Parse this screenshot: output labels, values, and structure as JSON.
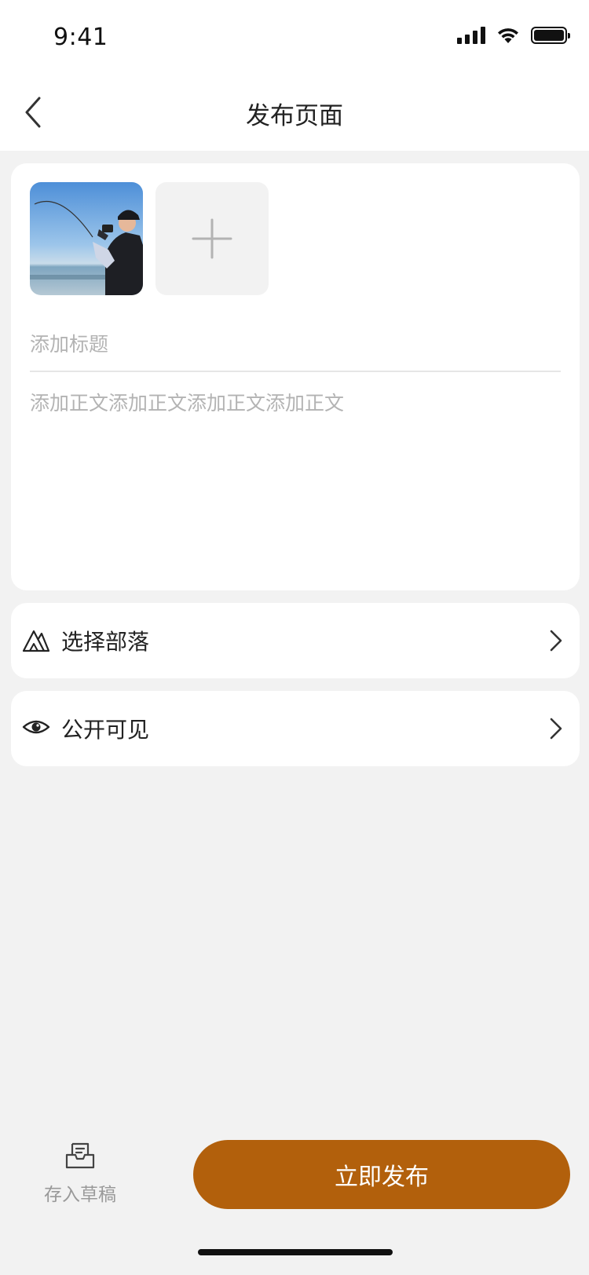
{
  "status_bar": {
    "time": "9:41",
    "icons": [
      "signal-icon",
      "wifi-icon",
      "battery-icon"
    ]
  },
  "header": {
    "back_icon": "chevron-left-icon",
    "title": "发布页面"
  },
  "editor": {
    "photos": [
      {
        "alt": "fishing-photo"
      }
    ],
    "add_photo_icon": "plus-icon",
    "title_placeholder": "添加标题",
    "body_placeholder": "添加正文添加正文添加正文添加正文"
  },
  "options": [
    {
      "icon": "mountains-icon",
      "label": "选择部落"
    },
    {
      "icon": "eye-icon",
      "label": "公开可见"
    }
  ],
  "footer": {
    "draft_icon": "draft-box-icon",
    "draft_label": "存入草稿",
    "publish_label": "立即发布"
  },
  "colors": {
    "accent": "#b2600c",
    "background": "#f2f2f2",
    "card": "#ffffff",
    "placeholder": "#b3b3b3"
  }
}
